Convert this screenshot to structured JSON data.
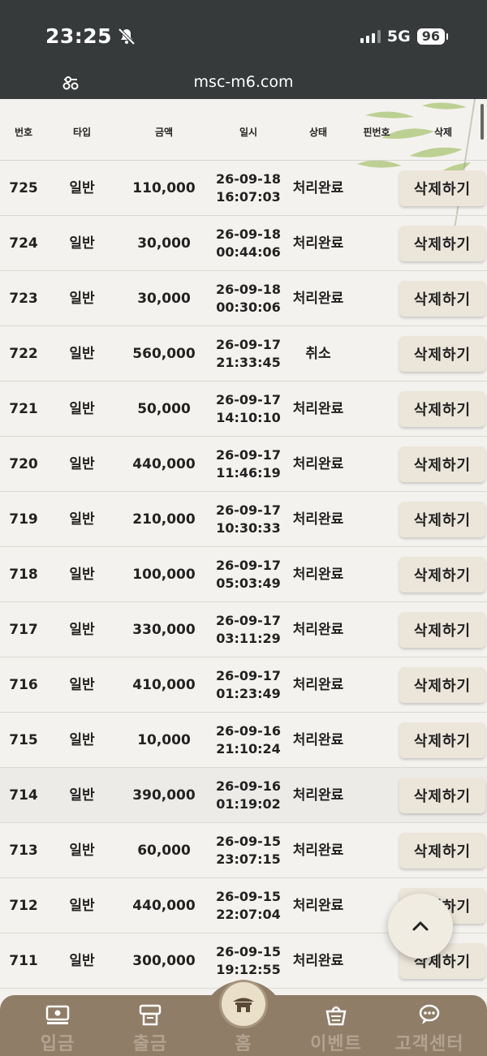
{
  "status": {
    "time": "23:25",
    "network": "5G",
    "battery": "96"
  },
  "browser": {
    "url": "msc-m6.com"
  },
  "table": {
    "headers": [
      "번호",
      "타입",
      "금액",
      "일시",
      "상태",
      "핀번호",
      "삭제"
    ],
    "delete_label": "삭제하기",
    "rows": [
      {
        "no": "725",
        "type": "일반",
        "amount": "110,000",
        "date": "26-09-18",
        "time": "16:07:03",
        "status": "처리완료"
      },
      {
        "no": "724",
        "type": "일반",
        "amount": "30,000",
        "date": "26-09-18",
        "time": "00:44:06",
        "status": "처리완료"
      },
      {
        "no": "723",
        "type": "일반",
        "amount": "30,000",
        "date": "26-09-18",
        "time": "00:30:06",
        "status": "처리완료"
      },
      {
        "no": "722",
        "type": "일반",
        "amount": "560,000",
        "date": "26-09-17",
        "time": "21:33:45",
        "status": "취소"
      },
      {
        "no": "721",
        "type": "일반",
        "amount": "50,000",
        "date": "26-09-17",
        "time": "14:10:10",
        "status": "처리완료"
      },
      {
        "no": "720",
        "type": "일반",
        "amount": "440,000",
        "date": "26-09-17",
        "time": "11:46:19",
        "status": "처리완료"
      },
      {
        "no": "719",
        "type": "일반",
        "amount": "210,000",
        "date": "26-09-17",
        "time": "10:30:33",
        "status": "처리완료"
      },
      {
        "no": "718",
        "type": "일반",
        "amount": "100,000",
        "date": "26-09-17",
        "time": "05:03:49",
        "status": "처리완료"
      },
      {
        "no": "717",
        "type": "일반",
        "amount": "330,000",
        "date": "26-09-17",
        "time": "03:11:29",
        "status": "처리완료"
      },
      {
        "no": "716",
        "type": "일반",
        "amount": "410,000",
        "date": "26-09-17",
        "time": "01:23:49",
        "status": "처리완료"
      },
      {
        "no": "715",
        "type": "일반",
        "amount": "10,000",
        "date": "26-09-16",
        "time": "21:10:24",
        "status": "처리완료"
      },
      {
        "no": "714",
        "type": "일반",
        "amount": "390,000",
        "date": "26-09-16",
        "time": "01:19:02",
        "status": "처리완료"
      },
      {
        "no": "713",
        "type": "일반",
        "amount": "60,000",
        "date": "26-09-15",
        "time": "23:07:15",
        "status": "처리완료"
      },
      {
        "no": "712",
        "type": "일반",
        "amount": "440,000",
        "date": "26-09-15",
        "time": "22:07:04",
        "status": "처리완료"
      },
      {
        "no": "711",
        "type": "일반",
        "amount": "300,000",
        "date": "26-09-15",
        "time": "19:12:55",
        "status": "처리완료"
      }
    ]
  },
  "nav": [
    {
      "label": "입금",
      "icon": "deposit-icon"
    },
    {
      "label": "출금",
      "icon": "withdraw-icon"
    },
    {
      "label": "홈",
      "icon": "home-icon"
    },
    {
      "label": "이벤트",
      "icon": "event-icon"
    },
    {
      "label": "고객센터",
      "icon": "support-icon"
    }
  ]
}
